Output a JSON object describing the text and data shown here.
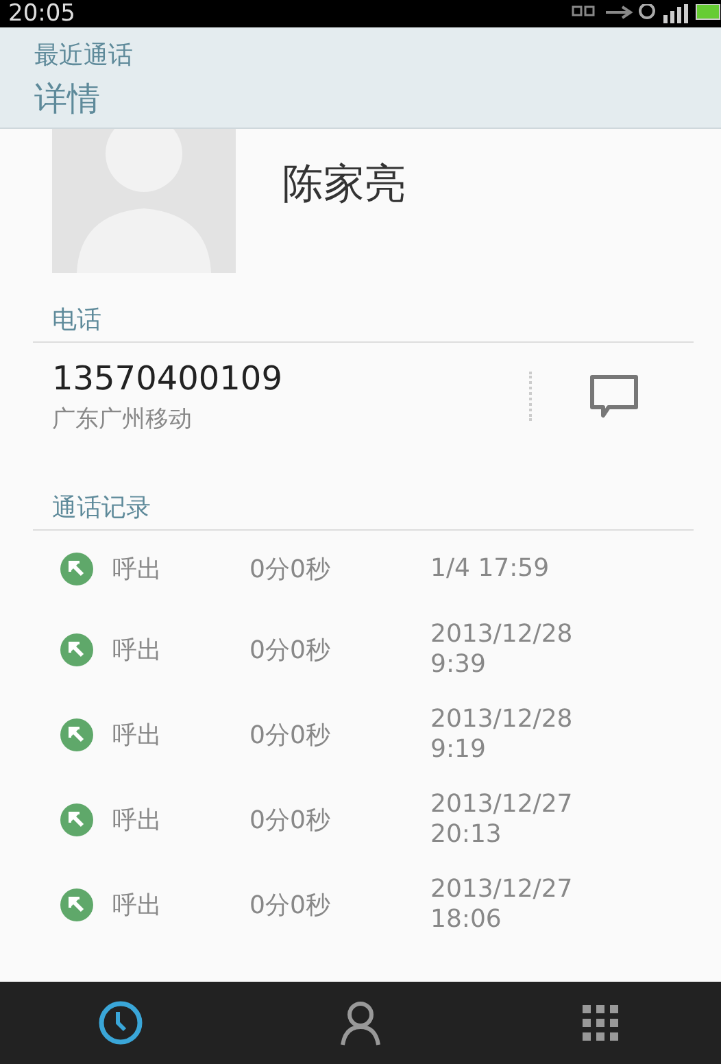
{
  "status_bar": {
    "time": "20:05"
  },
  "header": {
    "subtitle": "最近通话",
    "title": "详情"
  },
  "contact": {
    "name": "陈家亮"
  },
  "phone_section": {
    "heading": "电话",
    "number": "13570400109",
    "location": "广东广州移动"
  },
  "log_section": {
    "heading": "通话记录",
    "calls": [
      {
        "kind": "outgoing",
        "type": "呼出",
        "duration": "0分0秒",
        "when": "1/4 17:59"
      },
      {
        "kind": "outgoing",
        "type": "呼出",
        "duration": "0分0秒",
        "when": "2013/12/28 9:39"
      },
      {
        "kind": "outgoing",
        "type": "呼出",
        "duration": "0分0秒",
        "when": "2013/12/28 9:19"
      },
      {
        "kind": "outgoing",
        "type": "呼出",
        "duration": "0分0秒",
        "when": "2013/12/27 20:13"
      },
      {
        "kind": "outgoing",
        "type": "呼出",
        "duration": "0分0秒",
        "when": "2013/12/27 18:06"
      }
    ]
  },
  "bottom_tabs": [
    {
      "kind": "recent",
      "selected": true
    },
    {
      "kind": "contacts",
      "selected": false
    },
    {
      "kind": "dialpad",
      "selected": false
    }
  ]
}
